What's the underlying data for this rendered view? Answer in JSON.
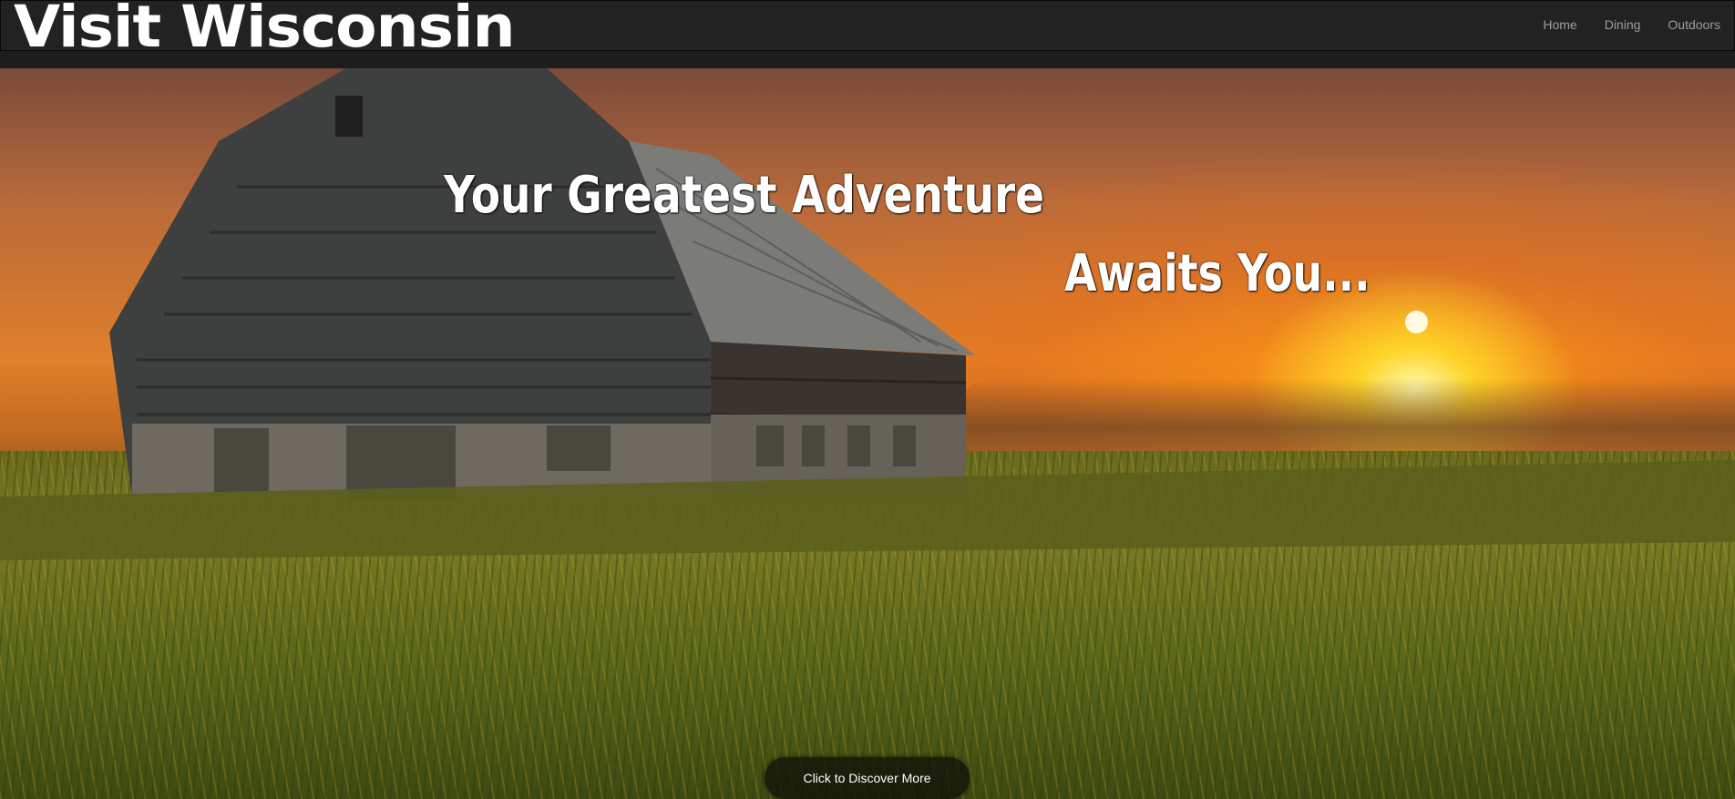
{
  "brand": {
    "title": "Visit Wisconsin"
  },
  "nav": {
    "items": [
      {
        "label": "Home"
      },
      {
        "label": "Dining"
      },
      {
        "label": "Outdoors"
      }
    ]
  },
  "hero": {
    "headline_line1": "Your Greatest Adventure",
    "headline_line2": "Awaits You...",
    "cta_label": "Click to Discover More",
    "image_description_icon": "barn-sunset-photo"
  },
  "colors": {
    "navbar_bg": "#222222",
    "nav_link": "#9d9d9d",
    "brand_text": "#ffffff",
    "cta_bg": "#14140a"
  }
}
